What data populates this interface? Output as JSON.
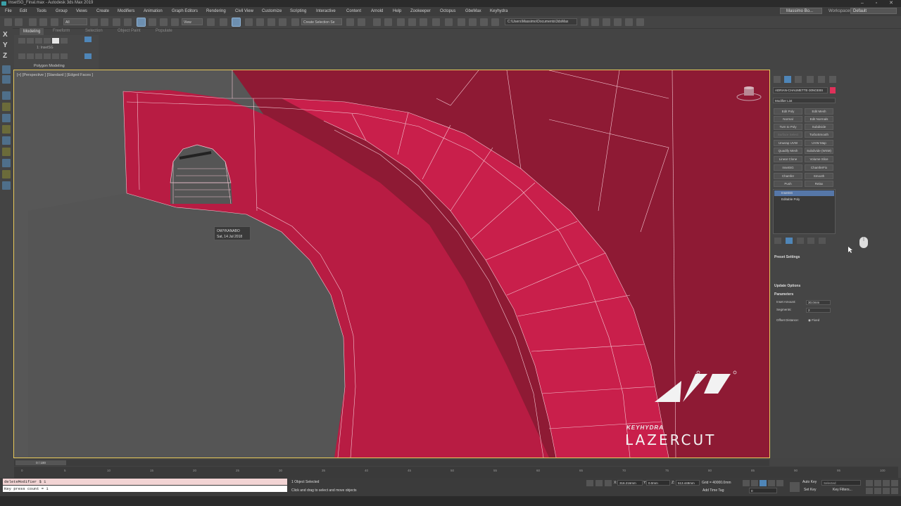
{
  "window": {
    "title": "InsetSG_Final.max - Autodesk 3ds Max 2019"
  },
  "menubar": {
    "items": [
      "File",
      "Edit",
      "Tools",
      "Group",
      "Views",
      "Create",
      "Modifiers",
      "Animation",
      "Graph Editors",
      "Rendering",
      "Civil View",
      "Customize",
      "Scripting",
      "Interactive",
      "Content",
      "Arnold",
      "Help",
      "Zookeeper",
      "Octopus",
      "GbeMax",
      "Keyhydra"
    ],
    "user": "Massimo Bo...",
    "workspaces_label": "Workspaces:",
    "workspace": "Default"
  },
  "toolbar": {
    "filter": "All",
    "ref_coord": "View",
    "selection_set": "Create Selection Se",
    "project_path": "C:\\Users\\Massimo\\Documents\\3dsMax"
  },
  "ribbon": {
    "tabs": [
      "Modeling",
      "Freeform",
      "Selection",
      "Object Paint",
      "Populate"
    ],
    "object": "1: InsetSG",
    "panel": "Polygon Modeling"
  },
  "left_toolbar": {
    "axes": [
      "X",
      "Y",
      "Z"
    ]
  },
  "viewport": {
    "label": "[+] [Perspective ] [Standard ] [Edged Faces ]",
    "tooltip": {
      "line1": "OWYKANABO",
      "line2": "Sat, 14 Jul 2018"
    },
    "brand_small": "KEYHYDRA",
    "brand_large": "LAZERCUT",
    "mesh_color": "#c41d45",
    "shadow_color": "#8e1a34"
  },
  "command_panel": {
    "object_name": "ADRIAN-CHAUMETTE-30NGE8S",
    "object_color": "#e0315a",
    "modifier_list": "Modifier List",
    "modifier_buttons": [
      [
        "Edit Poly",
        "Edit Mesh"
      ],
      [
        "Normal",
        "Edit Normals"
      ],
      [
        "Turn to Poly",
        "Subdivide"
      ],
      [
        "Surface Select",
        "TurboSmooth"
      ],
      [
        "Unwrap UVW",
        "UVW Map"
      ],
      [
        "Quadify Mesh",
        "Subdivide (WSM)"
      ],
      [
        "Linear Clone",
        "Volume Slice"
      ],
      [
        "InsetSG",
        "ChamferFix"
      ],
      [
        "Chamfer",
        "Smooth"
      ],
      [
        "Push",
        "Relax"
      ]
    ],
    "disabled_buttons": [
      "Surface Select"
    ],
    "stack": [
      "InsetSG",
      "Editable Poly"
    ],
    "rollouts": {
      "preset": "Preset Settings",
      "update": "Update Options",
      "parameters": "Parameters"
    },
    "params": {
      "inset_amount_label": "Inset Amount:",
      "inset_amount": "30.0mm",
      "segments_label": "Segments:",
      "segments": "2",
      "offset_label": "Offset Distance:",
      "offset_value": "Fixed"
    }
  },
  "timeline": {
    "frame": "0 / 100",
    "ticks": [
      "0",
      "5",
      "10",
      "15",
      "20",
      "25",
      "30",
      "35",
      "40",
      "45",
      "50",
      "55",
      "60",
      "65",
      "70",
      "75",
      "80",
      "85",
      "90",
      "95",
      "100"
    ]
  },
  "status": {
    "script_line1": "deleteModifier $ 1",
    "script_line2": "Key press count = 1",
    "selected": "1 Object Selected",
    "prompt": "Click and drag to select and move objects",
    "x_label": "X:",
    "x": "316.216mm",
    "y_label": "Y:",
    "y": "0.0mm",
    "z_label": "Z:",
    "z": "513.449mm",
    "grid": "Grid = 40000.0mm",
    "add_time_tag": "Add Time Tag",
    "auto_key": "Auto Key",
    "set_key": "Set Key",
    "selected_dd": "Selected",
    "key_filters": "Key Filters...",
    "frame_field": "0"
  }
}
